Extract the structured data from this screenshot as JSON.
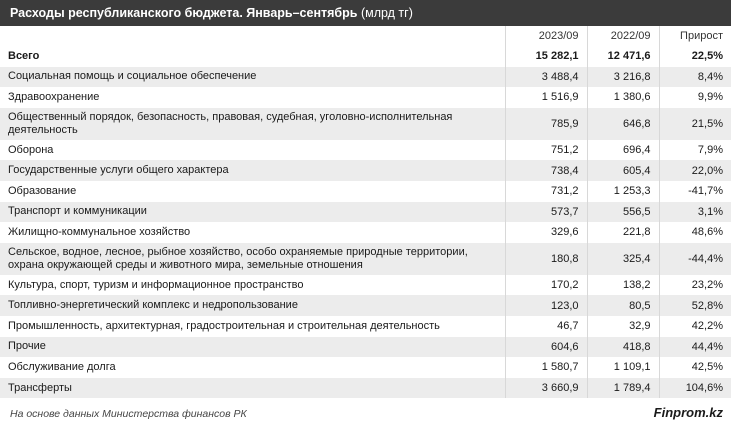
{
  "title": {
    "bold": "Расходы республиканского бюджета. Январь–сентябрь",
    "unit": "(млрд тг)"
  },
  "columns": [
    "",
    "2023/09",
    "2022/09",
    "Прирост"
  ],
  "rows": [
    {
      "name": "Всего",
      "v2023": "15 282,1",
      "v2022": "12 471,6",
      "growth": "22,5%"
    },
    {
      "name": "Социальная помощь и социальное обеспечение",
      "v2023": "3 488,4",
      "v2022": "3 216,8",
      "growth": "8,4%"
    },
    {
      "name": "Здравоохранение",
      "v2023": "1 516,9",
      "v2022": "1 380,6",
      "growth": "9,9%"
    },
    {
      "name": "Общественный порядок, безопасность, правовая, судебная, уголовно-исполнительная деятельность",
      "v2023": "785,9",
      "v2022": "646,8",
      "growth": "21,5%"
    },
    {
      "name": "Оборона",
      "v2023": "751,2",
      "v2022": "696,4",
      "growth": "7,9%"
    },
    {
      "name": "Государственные услуги общего характера",
      "v2023": "738,4",
      "v2022": "605,4",
      "growth": "22,0%"
    },
    {
      "name": "Образование",
      "v2023": "731,2",
      "v2022": "1 253,3",
      "growth": "-41,7%"
    },
    {
      "name": "Транспорт и коммуникации",
      "v2023": "573,7",
      "v2022": "556,5",
      "growth": "3,1%"
    },
    {
      "name": "Жилищно-коммунальное хозяйство",
      "v2023": "329,6",
      "v2022": "221,8",
      "growth": "48,6%"
    },
    {
      "name": "Сельское, водное, лесное, рыбное хозяйство, особо охраняемые природные территории, охрана окружающей среды и животного мира, земельные отношения",
      "v2023": "180,8",
      "v2022": "325,4",
      "growth": "-44,4%"
    },
    {
      "name": "Культура, спорт, туризм и информационное пространство",
      "v2023": "170,2",
      "v2022": "138,2",
      "growth": "23,2%"
    },
    {
      "name": "Топливно-энергетический комплекс и недропользование",
      "v2023": "123,0",
      "v2022": "80,5",
      "growth": "52,8%"
    },
    {
      "name": "Промышленность, архитектурная, градостроительная и строительная деятельность",
      "v2023": "46,7",
      "v2022": "32,9",
      "growth": "42,2%"
    },
    {
      "name": "Прочие",
      "v2023": "604,6",
      "v2022": "418,8",
      "growth": "44,4%"
    },
    {
      "name": "Обслуживание долга",
      "v2023": "1 580,7",
      "v2022": "1 109,1",
      "growth": "42,5%"
    },
    {
      "name": "Трансферты",
      "v2023": "3 660,9",
      "v2022": "1 789,4",
      "growth": "104,6%"
    }
  ],
  "footer": {
    "source": "На основе данных Министерства финансов РК",
    "brand": "Finprom.kz"
  }
}
